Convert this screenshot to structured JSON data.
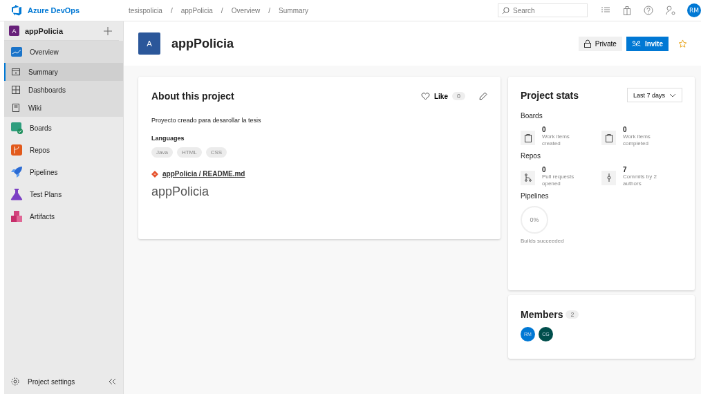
{
  "header": {
    "brand": "Azure DevOps",
    "breadcrumb": [
      "tesispolicia",
      "appPolicia",
      "Overview",
      "Summary"
    ],
    "separator": "/",
    "search": {
      "placeholder": "Search"
    },
    "user": "RM"
  },
  "sidebar": {
    "project": {
      "initial": "A",
      "name": "appPolicia"
    },
    "items": [
      {
        "label": "Overview",
        "selected": false,
        "expanded": true,
        "children": [
          {
            "label": "Summary",
            "selected": true
          },
          {
            "label": "Dashboards",
            "selected": false
          },
          {
            "label": "Wiki",
            "selected": false
          }
        ]
      },
      {
        "label": "Boards",
        "selected": false
      },
      {
        "label": "Repos",
        "selected": false
      },
      {
        "label": "Pipelines",
        "selected": false
      },
      {
        "label": "Test Plans",
        "selected": false
      },
      {
        "label": "Artifacts",
        "selected": false
      }
    ],
    "settings": "Project settings"
  },
  "page": {
    "initial": "A",
    "title": "appPolicia",
    "visibility": "Private",
    "invite": "Invite"
  },
  "about": {
    "title": "About this project",
    "like": "Like",
    "like_count": "0",
    "description": "Proyecto creado para desarollar la tesis",
    "languages_label": "Languages",
    "languages": [
      "Java",
      "HTML",
      "CSS"
    ],
    "readme_link": "appPolicia / README.md",
    "readme_heading": "appPolicia"
  },
  "stats": {
    "title": "Project stats",
    "range": "Last 7 days",
    "sections": [
      {
        "title": "Boards",
        "stats": [
          {
            "value": "0",
            "label": "Work items created"
          },
          {
            "value": "0",
            "label": "Work items completed"
          }
        ]
      },
      {
        "title": "Repos",
        "stats": [
          {
            "value": "0",
            "label": "Pull requests opened"
          },
          {
            "value": "7",
            "label": "Commits by 2 authors"
          }
        ]
      }
    ],
    "pipelines": {
      "title": "Pipelines",
      "percent": "0%",
      "label": "Builds succeeded"
    }
  },
  "members": {
    "title": "Members",
    "count": "2",
    "people": [
      {
        "initials": "RM",
        "color": "#0078d4"
      },
      {
        "initials": "CG",
        "color": "#004e4c"
      }
    ]
  }
}
